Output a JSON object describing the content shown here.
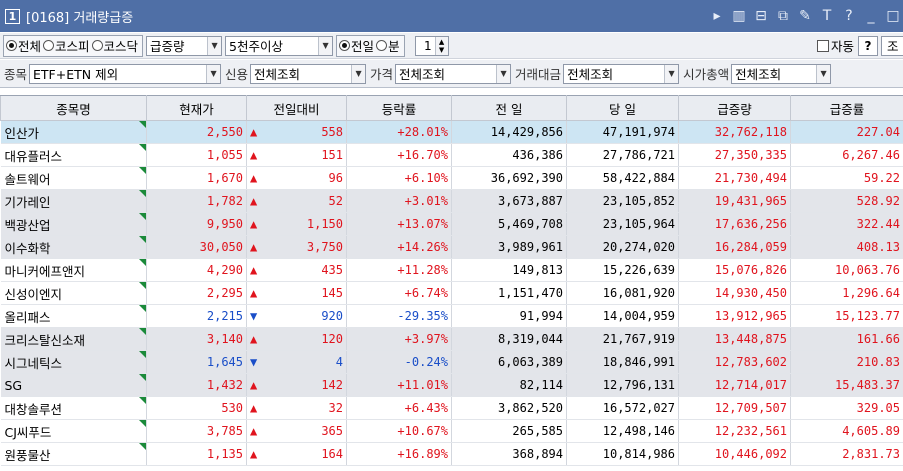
{
  "window": {
    "number": "1",
    "title": "[0168] 거래량급증"
  },
  "title_icons": [
    "arrow-right-icon",
    "window-icon",
    "layout-icon",
    "popup-icon",
    "pin-icon",
    "font-icon",
    "help-icon",
    "minimize-icon",
    "maximize-icon"
  ],
  "title_glyphs": [
    "▸",
    "▥",
    "⊟",
    "⧉",
    "✎",
    "T",
    "?",
    "_",
    "□"
  ],
  "toolbar": {
    "market_radios": [
      {
        "label": "전체",
        "checked": true
      },
      {
        "label": "코스피",
        "checked": false
      },
      {
        "label": "코스닥",
        "checked": false
      }
    ],
    "sort_select": "급증량",
    "volume_select": "5천주이상",
    "period_radios": [
      {
        "label": "전일",
        "checked": true
      },
      {
        "label": "분",
        "checked": false
      }
    ],
    "spin_value": "1",
    "auto_label": "자동",
    "help_label": "?",
    "query_label": "조"
  },
  "filters": [
    {
      "label": "종목",
      "value": "ETF+ETN 제외",
      "width": 192
    },
    {
      "label": "신용",
      "value": "전체조회",
      "width": 116
    },
    {
      "label": "가격",
      "value": "전체조회",
      "width": 116
    },
    {
      "label": "거래대금",
      "value": "전체조회",
      "width": 116
    },
    {
      "label": "시가총액",
      "value": "전체조회",
      "width": 100
    }
  ],
  "columns": [
    "종목명",
    "현재가",
    "전일대비",
    "등락률",
    "전 일",
    "당 일",
    "급증량",
    "급증률"
  ],
  "colors": {
    "up": "#e0141e",
    "down": "#1a4ec8",
    "selected": "#cde5f3",
    "header": "#4f6fa6"
  },
  "rows": [
    {
      "name": "인산가",
      "price": "2,550",
      "dir": "up",
      "change": "558",
      "rate": "+28.01%",
      "prev": "14,429,856",
      "today": "47,191,974",
      "surge": "32,762,118",
      "surge_rate": "227.04",
      "bg": "sel"
    },
    {
      "name": "대유플러스",
      "price": "1,055",
      "dir": "up",
      "change": "151",
      "rate": "+16.70%",
      "prev": "436,386",
      "today": "27,786,721",
      "surge": "27,350,335",
      "surge_rate": "6,267.46",
      "bg": "w"
    },
    {
      "name": "솔트웨어",
      "price": "1,670",
      "dir": "up",
      "change": "96",
      "rate": "+6.10%",
      "prev": "36,692,390",
      "today": "58,422,884",
      "surge": "21,730,494",
      "surge_rate": "59.22",
      "bg": "w"
    },
    {
      "name": "기가레인",
      "price": "1,782",
      "dir": "up",
      "change": "52",
      "rate": "+3.01%",
      "prev": "3,673,887",
      "today": "23,105,852",
      "surge": "19,431,965",
      "surge_rate": "528.92",
      "bg": "g"
    },
    {
      "name": "백광산업",
      "price": "9,950",
      "dir": "up",
      "change": "1,150",
      "rate": "+13.07%",
      "prev": "5,469,708",
      "today": "23,105,964",
      "surge": "17,636,256",
      "surge_rate": "322.44",
      "bg": "g"
    },
    {
      "name": "이수화학",
      "price": "30,050",
      "dir": "up",
      "change": "3,750",
      "rate": "+14.26%",
      "prev": "3,989,961",
      "today": "20,274,020",
      "surge": "16,284,059",
      "surge_rate": "408.13",
      "bg": "g"
    },
    {
      "name": "마니커에프앤지",
      "price": "4,290",
      "dir": "up",
      "change": "435",
      "rate": "+11.28%",
      "prev": "149,813",
      "today": "15,226,639",
      "surge": "15,076,826",
      "surge_rate": "10,063.76",
      "bg": "w"
    },
    {
      "name": "신성이엔지",
      "price": "2,295",
      "dir": "up",
      "change": "145",
      "rate": "+6.74%",
      "prev": "1,151,470",
      "today": "16,081,920",
      "surge": "14,930,450",
      "surge_rate": "1,296.64",
      "bg": "w"
    },
    {
      "name": "올리패스",
      "price": "2,215",
      "dir": "down",
      "change": "920",
      "rate": "-29.35%",
      "prev": "91,994",
      "today": "14,004,959",
      "surge": "13,912,965",
      "surge_rate": "15,123.77",
      "bg": "w"
    },
    {
      "name": "크리스탈신소재",
      "price": "3,140",
      "dir": "up",
      "change": "120",
      "rate": "+3.97%",
      "prev": "8,319,044",
      "today": "21,767,919",
      "surge": "13,448,875",
      "surge_rate": "161.66",
      "bg": "g"
    },
    {
      "name": "시그네틱스",
      "price": "1,645",
      "dir": "down",
      "change": "4",
      "rate": "-0.24%",
      "prev": "6,063,389",
      "today": "18,846,991",
      "surge": "12,783,602",
      "surge_rate": "210.83",
      "bg": "g"
    },
    {
      "name": "SG",
      "price": "1,432",
      "dir": "up",
      "change": "142",
      "rate": "+11.01%",
      "prev": "82,114",
      "today": "12,796,131",
      "surge": "12,714,017",
      "surge_rate": "15,483.37",
      "bg": "g"
    },
    {
      "name": "대창솔루션",
      "price": "530",
      "dir": "up",
      "change": "32",
      "rate": "+6.43%",
      "prev": "3,862,520",
      "today": "16,572,027",
      "surge": "12,709,507",
      "surge_rate": "329.05",
      "bg": "w"
    },
    {
      "name": "CJ씨푸드",
      "price": "3,785",
      "dir": "up",
      "change": "365",
      "rate": "+10.67%",
      "prev": "265,585",
      "today": "12,498,146",
      "surge": "12,232,561",
      "surge_rate": "4,605.89",
      "bg": "w"
    },
    {
      "name": "원풍물산",
      "price": "1,135",
      "dir": "up",
      "change": "164",
      "rate": "+16.89%",
      "prev": "368,894",
      "today": "10,814,986",
      "surge": "10,446,092",
      "surge_rate": "2,831.73",
      "bg": "w"
    }
  ]
}
